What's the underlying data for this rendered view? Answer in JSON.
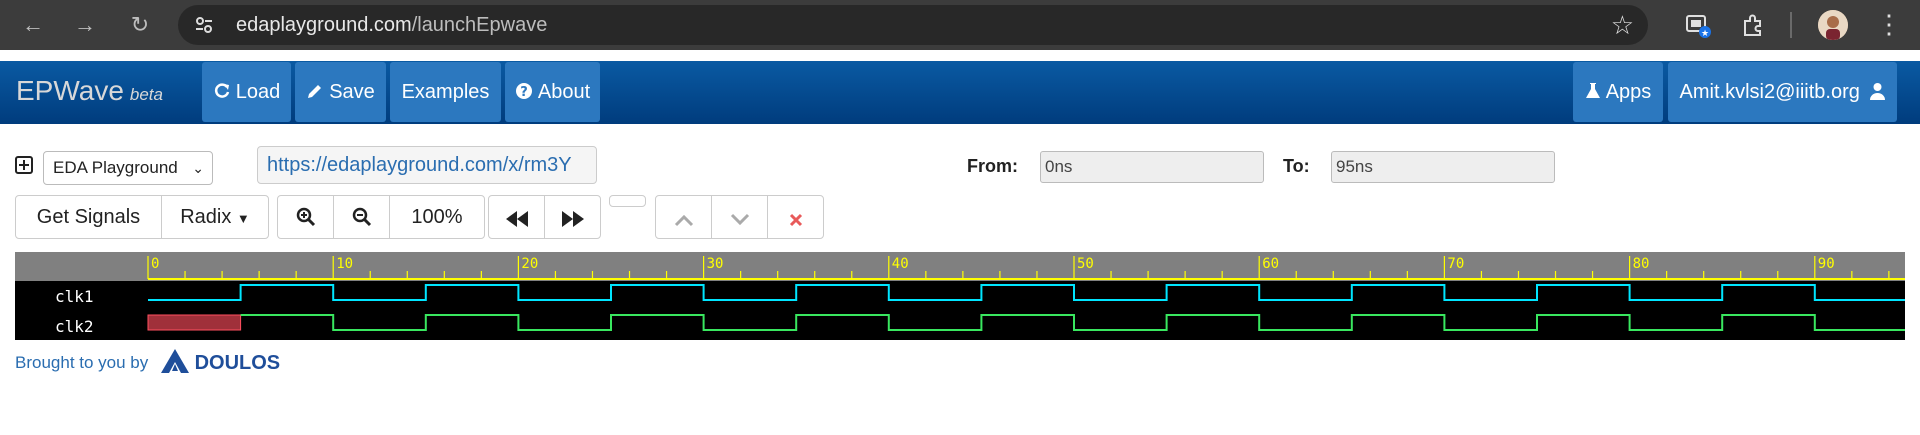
{
  "browser": {
    "url_host": "edaplayground.com",
    "url_path": "/launchEpwave",
    "icons": [
      "back-icon",
      "forward-icon",
      "reload-icon",
      "site-settings-icon",
      "bookmark-star-icon",
      "tab-search-icon",
      "extensions-icon",
      "profile-avatar",
      "more-menu-icon"
    ]
  },
  "navbar": {
    "brand": "EPWave",
    "brand_suffix": "beta",
    "load": "Load",
    "save": "Save",
    "examples": "Examples",
    "about": "About",
    "apps": "Apps",
    "user": "Amit.kvlsi2@iiitb.org"
  },
  "toolbar": {
    "source_select": "EDA Playground",
    "share_url": "https://edaplayground.com/x/rm3Y",
    "from_label": "From:",
    "from_value": "0ns",
    "to_label": "To:",
    "to_value": "95ns",
    "get_signals": "Get Signals",
    "radix": "Radix",
    "zoom_level": "100%"
  },
  "waveform": {
    "time_start": 0,
    "time_end": 95,
    "tick_labels": [
      "0",
      "10",
      "20",
      "30",
      "40",
      "50",
      "60",
      "70",
      "80",
      "90"
    ],
    "signals": [
      {
        "name": "clk1",
        "color": "#00e5ff",
        "period": 10,
        "initial": 0,
        "first_edge": 5
      },
      {
        "name": "clk2",
        "color": "#39e75f",
        "period": 10,
        "initial": "x",
        "first_edge": 5
      }
    ],
    "ruler_color": "#ffff00",
    "selection_color": "#a0303a"
  },
  "footer": {
    "brought": "Brought to you by",
    "brand": "DOULOS"
  }
}
